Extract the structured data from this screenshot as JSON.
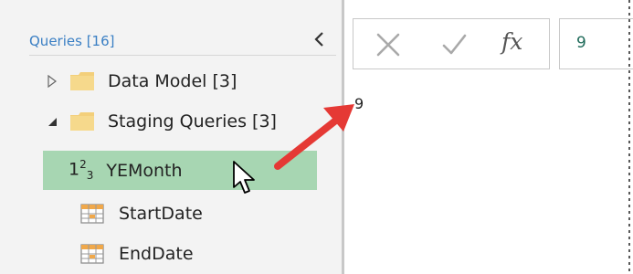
{
  "queries_pane": {
    "header": "Queries [16]",
    "collapse_icon": "chevron-left-icon",
    "groups": [
      {
        "label": "Data Model [3]",
        "expanded": false
      },
      {
        "label": "Staging Queries [3]",
        "expanded": true
      }
    ],
    "items": [
      {
        "label": "YEMonth",
        "icon": "number-type-icon",
        "selected": true
      },
      {
        "label": "StartDate",
        "icon": "table-icon",
        "selected": false
      },
      {
        "label": "EndDate",
        "icon": "table-icon",
        "selected": false
      }
    ],
    "number_icon_text": {
      "base": "1",
      "sup": "2",
      "sub": "3"
    }
  },
  "formula_bar": {
    "fx_label": "fx",
    "value": "9"
  },
  "result": {
    "value": "9"
  },
  "colors": {
    "selected_row": "#a7d6b2",
    "header_link": "#3a7fc4",
    "arrow": "#e53935",
    "formula_value": "#1f6b5a"
  }
}
